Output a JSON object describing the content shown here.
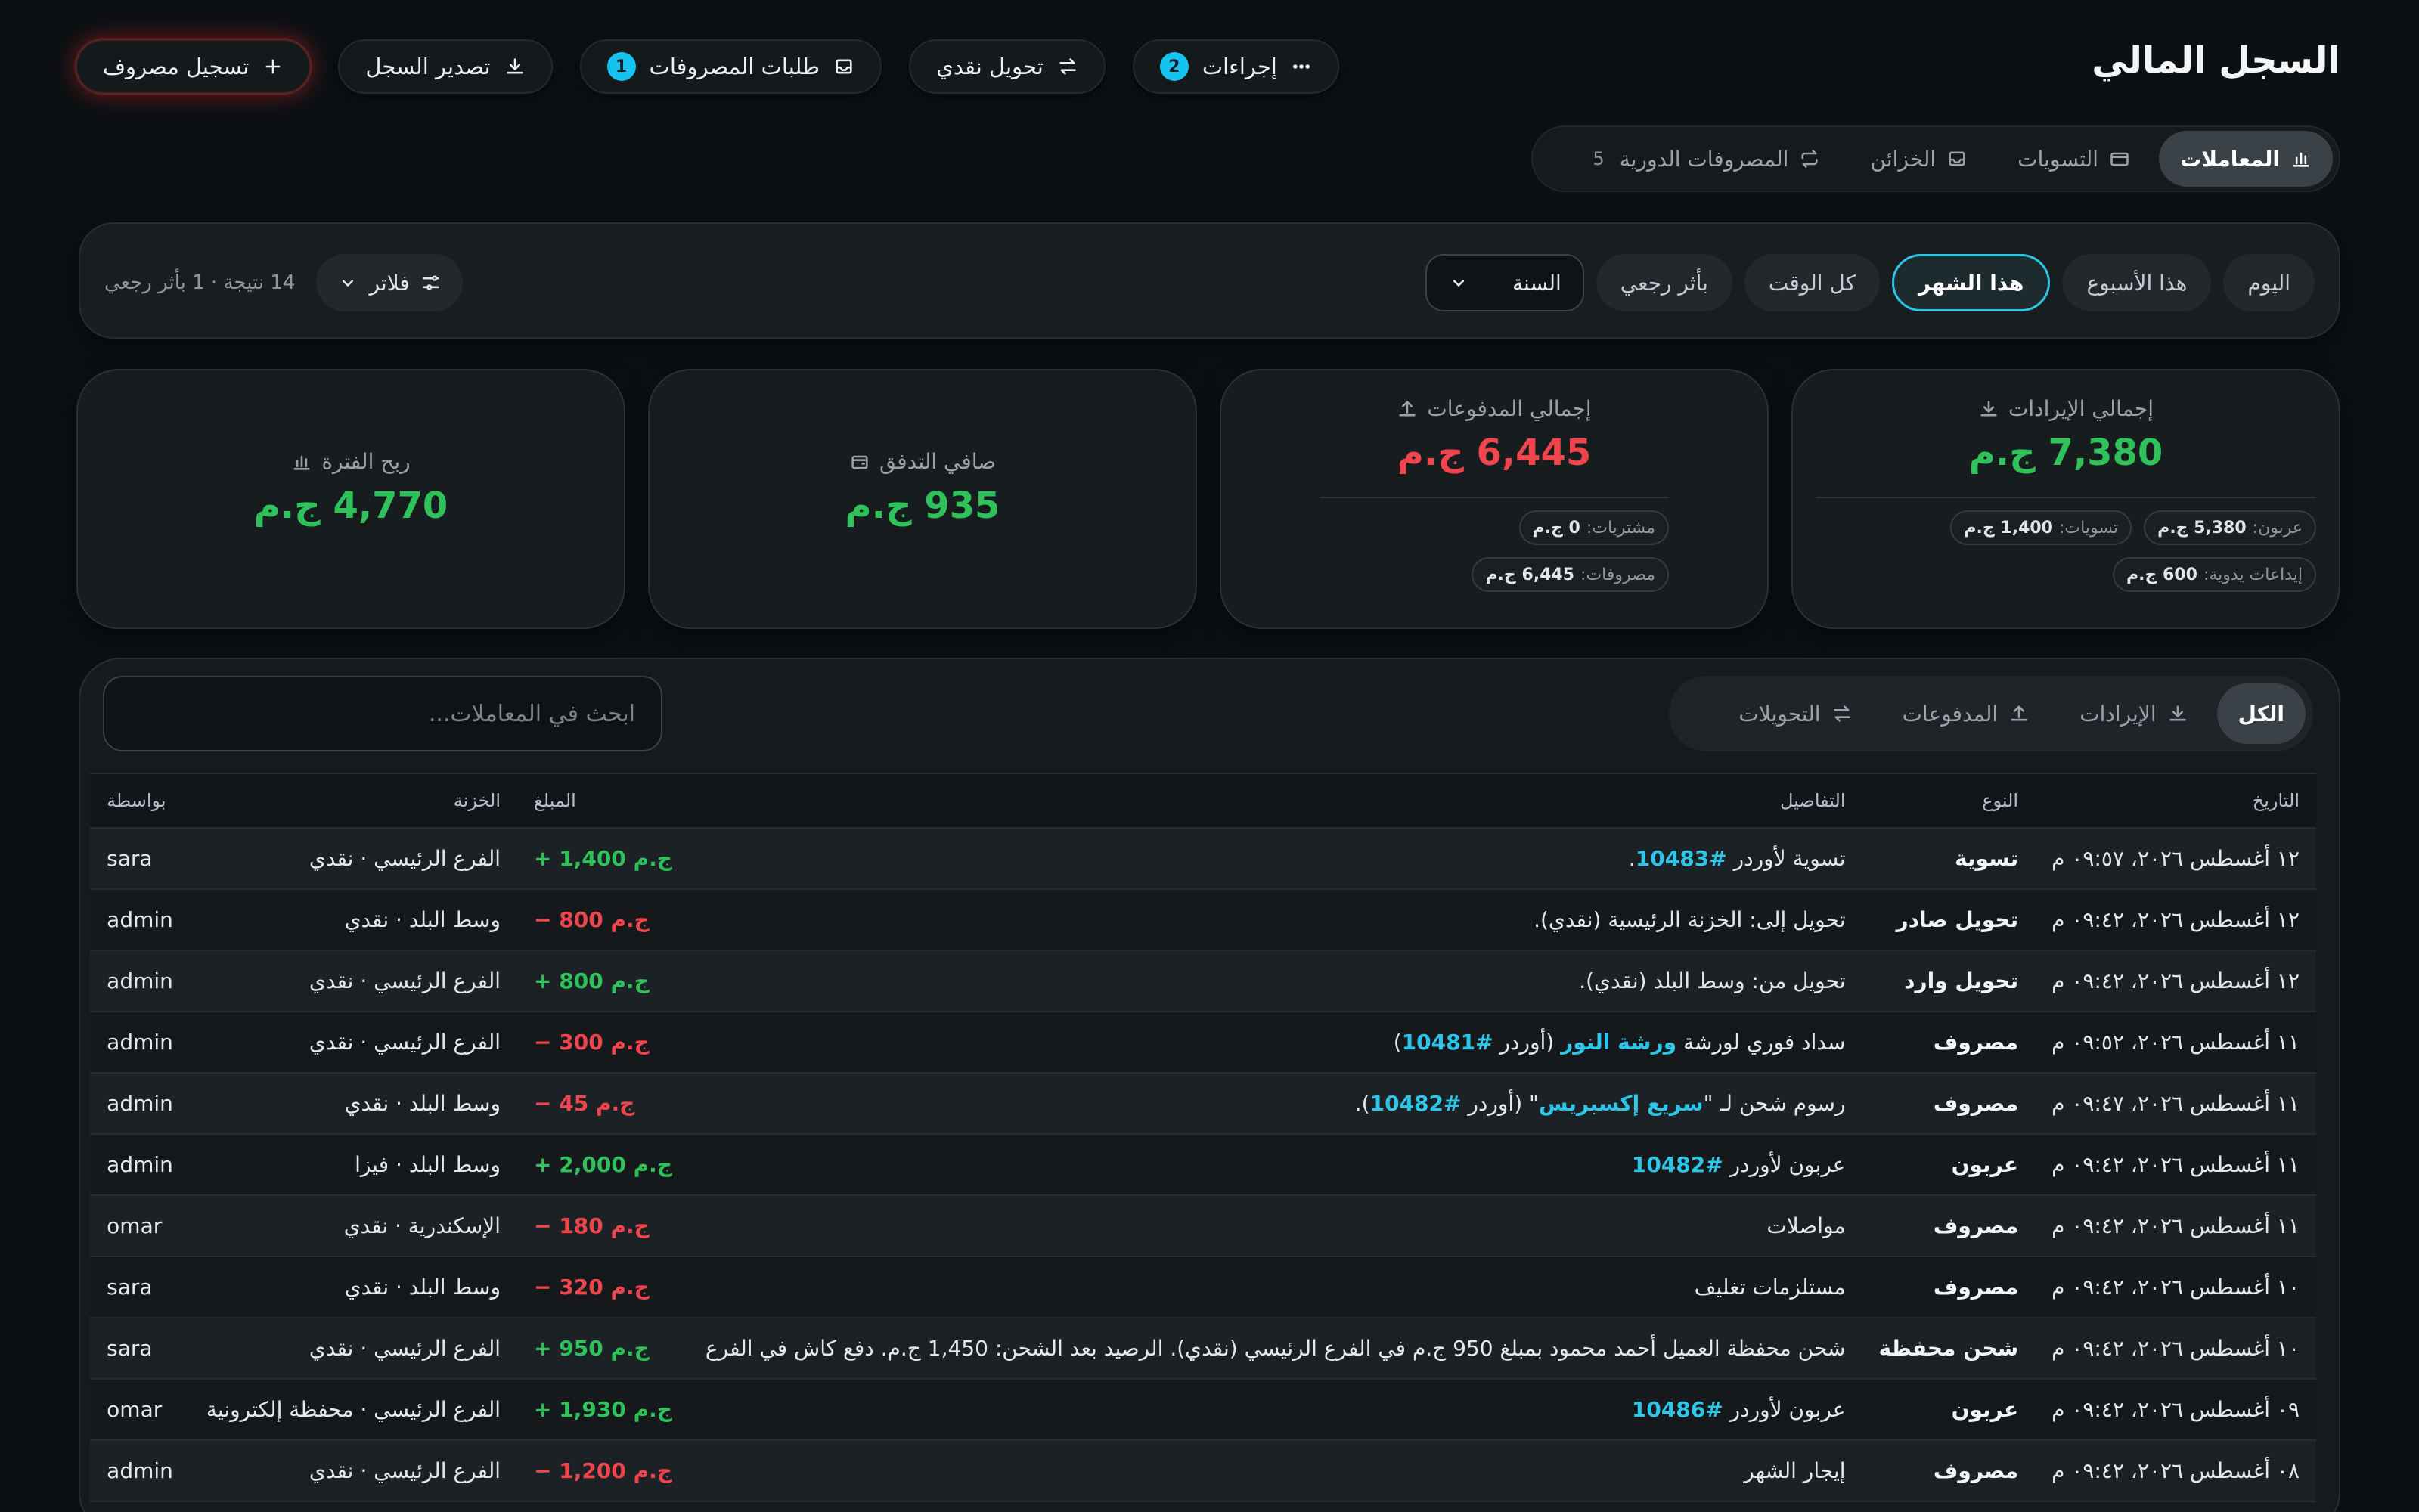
{
  "page": {
    "title": "السجل المالي"
  },
  "actions": {
    "more": {
      "label": "إجراءات",
      "badge": "2"
    },
    "transfer": {
      "label": "تحويل نقدي"
    },
    "requests": {
      "label": "طلبات المصروفات",
      "badge": "1"
    },
    "export": {
      "label": "تصدير السجل"
    },
    "add_expense": {
      "label": "تسجيل مصروف"
    }
  },
  "tabs": {
    "transactions": "المعاملات",
    "settlements": "التسويات",
    "treasuries": "الخزائن",
    "recurring": "المصروفات الدورية",
    "recurring_count": "5"
  },
  "periods": {
    "today": "اليوم",
    "week": "هذا الأسبوع",
    "month": "هذا الشهر",
    "all": "كل الوقت",
    "retro": "بأثر رجعي",
    "year": "السنة"
  },
  "filter": {
    "label": "فلاتر",
    "result": "14 نتيجة · 1 بأثر رجعي"
  },
  "cards": {
    "revenue": {
      "title": "إجمالي الإيرادات",
      "value": "7,380 ج.م",
      "chips": [
        {
          "label": "عربون:",
          "value": "5,380 ج.م"
        },
        {
          "label": "تسويات:",
          "value": "1,400 ج.م"
        },
        {
          "label": "إيداعات يدوية:",
          "value": "600 ج.م"
        }
      ]
    },
    "payments": {
      "title": "إجمالي المدفوعات",
      "value": "6,445 ج.م",
      "chips": [
        {
          "label": "مشتريات:",
          "value": "0 ج.م"
        },
        {
          "label": "مصروفات:",
          "value": "6,445 ج.م"
        }
      ]
    },
    "net": {
      "title": "صافي التدفق",
      "value": "935 ج.م"
    },
    "profit": {
      "title": "ربح الفترة",
      "value": "4,770 ج.م"
    }
  },
  "ledger": {
    "seg": {
      "all": "الكل",
      "revenue": "الإيرادات",
      "payments": "المدفوعات",
      "transfers": "التحويلات"
    },
    "search_placeholder": "ابحث في المعاملات...",
    "columns": {
      "date": "التاريخ",
      "type": "النوع",
      "details": "التفاصيل",
      "amount": "المبلغ",
      "treasury": "الخزنة",
      "by": "بواسطة"
    },
    "rows": [
      {
        "date": "١٢ أغسطس ٢٠٢٦، ٠٩:٥٧ م",
        "type": "تسوية",
        "details": [
          {
            "t": "تسوية لأوردر "
          },
          {
            "t": "#10483",
            "link": true
          },
          {
            "t": "."
          }
        ],
        "amount": "+ 1,400 ج.م",
        "sign": "pos",
        "treasury": "الفرع الرئيسي · نقدي",
        "by": "sara"
      },
      {
        "date": "١٢ أغسطس ٢٠٢٦، ٠٩:٤٢ م",
        "type": "تحويل صادر",
        "details": [
          {
            "t": "تحويل إلى: الخزنة الرئيسية (نقدي)."
          }
        ],
        "amount": "− 800 ج.م",
        "sign": "neg",
        "treasury": "وسط البلد · نقدي",
        "by": "admin"
      },
      {
        "date": "١٢ أغسطس ٢٠٢٦، ٠٩:٤٢ م",
        "type": "تحويل وارد",
        "details": [
          {
            "t": "تحويل من: وسط البلد (نقدي)."
          }
        ],
        "amount": "+ 800 ج.م",
        "sign": "pos",
        "treasury": "الفرع الرئيسي · نقدي",
        "by": "admin"
      },
      {
        "date": "١١ أغسطس ٢٠٢٦، ٠٩:٥٢ م",
        "type": "مصروف",
        "details": [
          {
            "t": "سداد فوري لورشة "
          },
          {
            "t": "ورشة النور",
            "link": true
          },
          {
            "t": " (أوردر "
          },
          {
            "t": "#10481",
            "link": true
          },
          {
            "t": ")"
          }
        ],
        "amount": "− 300 ج.م",
        "sign": "neg",
        "treasury": "الفرع الرئيسي · نقدي",
        "by": "admin"
      },
      {
        "date": "١١ أغسطس ٢٠٢٦، ٠٩:٤٧ م",
        "type": "مصروف",
        "details": [
          {
            "t": "رسوم شحن لـ \""
          },
          {
            "t": "سريع إكسبريس",
            "link": true
          },
          {
            "t": "\" (أوردر "
          },
          {
            "t": "#10482",
            "link": true
          },
          {
            "t": ")."
          }
        ],
        "amount": "− 45 ج.م",
        "sign": "neg",
        "treasury": "وسط البلد · نقدي",
        "by": "admin"
      },
      {
        "date": "١١ أغسطس ٢٠٢٦، ٠٩:٤٢ م",
        "type": "عربون",
        "details": [
          {
            "t": "عربون لأوردر "
          },
          {
            "t": "#10482",
            "link": true
          }
        ],
        "amount": "+ 2,000 ج.م",
        "sign": "pos",
        "treasury": "وسط البلد · فيزا",
        "by": "admin"
      },
      {
        "date": "١١ أغسطس ٢٠٢٦، ٠٩:٤٢ م",
        "type": "مصروف",
        "details": [
          {
            "t": "مواصلات"
          }
        ],
        "amount": "− 180 ج.م",
        "sign": "neg",
        "treasury": "الإسكندرية · نقدي",
        "by": "omar"
      },
      {
        "date": "١٠ أغسطس ٢٠٢٦، ٠٩:٤٢ م",
        "type": "مصروف",
        "details": [
          {
            "t": "مستلزمات تغليف"
          }
        ],
        "amount": "− 320 ج.م",
        "sign": "neg",
        "treasury": "وسط البلد · نقدي",
        "by": "sara"
      },
      {
        "date": "١٠ أغسطس ٢٠٢٦، ٠٩:٤٢ م",
        "type": "شحن محفظة",
        "details": [
          {
            "t": "شحن محفظة العميل أحمد محمود بمبلغ 950 ج.م في الفرع الرئيسي (نقدي). الرصيد بعد الشحن: 1,450 ج.م. دفع كاش في الفرع"
          }
        ],
        "amount": "+ 950 ج.م",
        "sign": "pos",
        "treasury": "الفرع الرئيسي · نقدي",
        "by": "sara"
      },
      {
        "date": "٠٩ أغسطس ٢٠٢٦، ٠٩:٤٢ م",
        "type": "عربون",
        "details": [
          {
            "t": "عربون لأوردر "
          },
          {
            "t": "#10486",
            "link": true
          }
        ],
        "amount": "+ 1,930 ج.م",
        "sign": "pos",
        "treasury": "الفرع الرئيسي · محفظة إلكترونية",
        "by": "omar"
      },
      {
        "date": "٠٨ أغسطس ٢٠٢٦، ٠٩:٤٢ م",
        "type": "مصروف",
        "details": [
          {
            "t": "إيجار الشهر"
          }
        ],
        "amount": "− 1,200 ج.م",
        "sign": "neg",
        "treasury": "الفرع الرئيسي · نقدي",
        "by": "admin"
      }
    ]
  }
}
